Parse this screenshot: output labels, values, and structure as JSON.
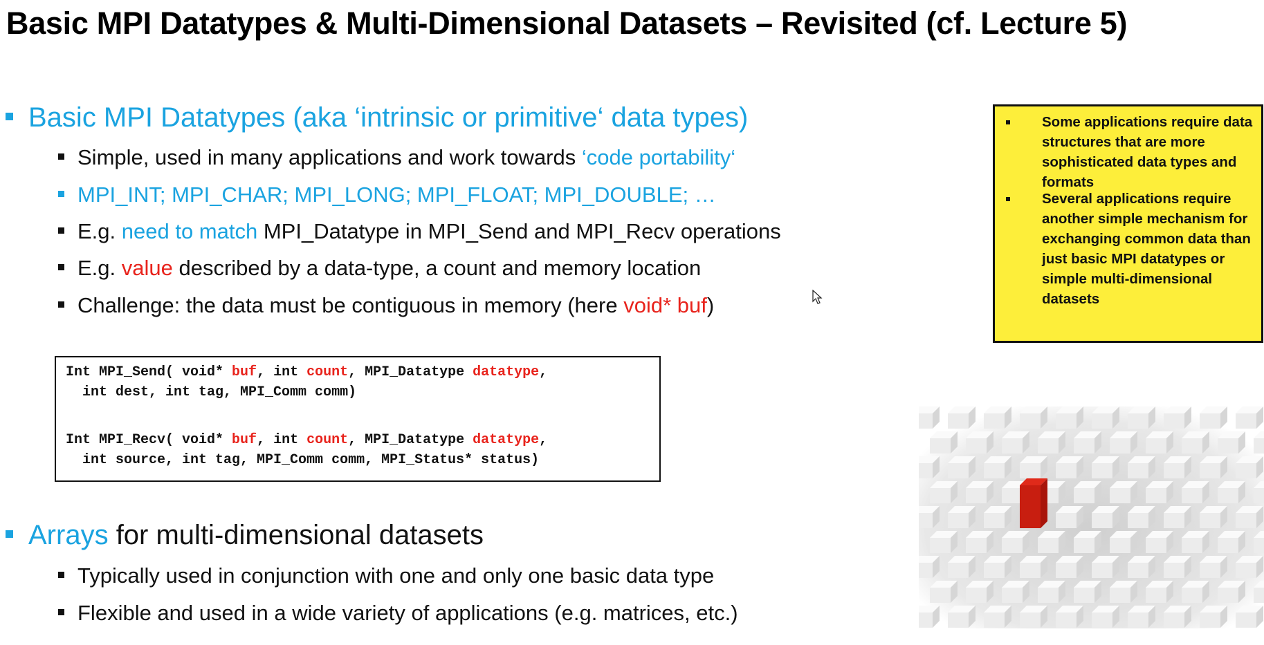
{
  "title": "Basic MPI Datatypes & Multi-Dimensional Datasets – Revisited (cf. Lecture 5)",
  "section1": {
    "heading": "Basic MPI Datatypes (aka ‘intrinsic or primitive‘ data types)",
    "items": [
      {
        "a": "Simple, used in many applications and work towards ",
        "b": "‘code portability‘"
      },
      {
        "a": "MPI_INT; MPI_CHAR; MPI_LONG; MPI_FLOAT; MPI_DOUBLE; …"
      },
      {
        "a": "E.g. ",
        "b": "need to match",
        "c": " MPI_Datatype in MPI_Send and MPI_Recv operations"
      },
      {
        "a": "E.g. ",
        "b": "value",
        "c": " described by a data-type, a count and memory location"
      },
      {
        "a": "Challenge: the data must be contiguous in memory (here ",
        "b": "void* buf",
        "c": ")"
      }
    ]
  },
  "code": {
    "send_l1": {
      "a": "Int MPI_Send( void* ",
      "b": "buf",
      "c": ", int ",
      "d": "count",
      "e": ", MPI_Datatype ",
      "f": "datatype",
      "g": ","
    },
    "send_l2": "  int dest, int tag, MPI_Comm comm)",
    "recv_l1": {
      "a": "Int MPI_Recv( void* ",
      "b": "buf",
      "c": ", int ",
      "d": "count",
      "e": ", MPI_Datatype ",
      "f": "datatype",
      "g": ","
    },
    "recv_l2": "  int source, int tag, MPI_Comm comm, MPI_Status* status)"
  },
  "section2": {
    "heading_a": "Arrays",
    "heading_b": " for multi-dimensional datasets",
    "items": [
      "Typically used in conjunction with one and only one basic data type",
      "Flexible and used in a wide variety of applications (e.g. matrices, etc.)"
    ]
  },
  "note": {
    "items": [
      "Some applications require data structures that are more sophisticated data types and formats",
      "Several applications require another simple mechanism for exchanging common data than just basic MPI datatypes or simple multi-dimensional datasets"
    ]
  },
  "colors": {
    "accent": "#1aa3e0",
    "highlight": "#e8231c",
    "note_bg": "#fdee3a"
  },
  "icons": [
    "mouse-cursor-icon",
    "cube-grid-image"
  ]
}
